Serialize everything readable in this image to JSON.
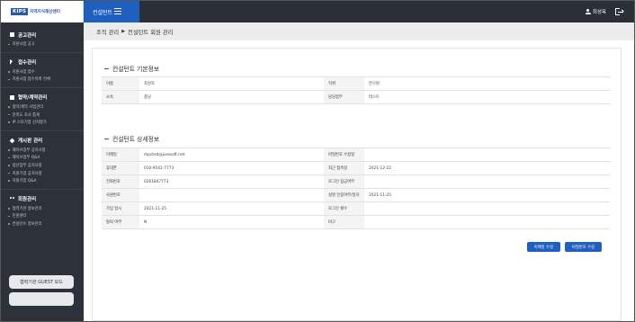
{
  "header": {
    "logo_mark": "KIPS",
    "logo_text": "지역지식재산센터",
    "brand": "컨설턴트",
    "user_name": "최성옥"
  },
  "sidebar": {
    "sections": [
      {
        "title": "공고관리",
        "icon": "document-icon",
        "items": [
          "지원사업 공고"
        ]
      },
      {
        "title": "접수관리",
        "icon": "cursor-icon",
        "items": [
          "지원사업 접수",
          "지원사업 접수목록 전체"
        ]
      },
      {
        "title": "협약/계약관리",
        "icon": "document-icon",
        "items": [
          "협약/계약 사업관리",
          "만족도 조사 통계",
          "IP 스타기업 선처평가"
        ]
      },
      {
        "title": "게시판 관리",
        "icon": "pencil-icon",
        "items": [
          "웨이브업무 공지사항",
          "웨이브업무 Q&A",
          "정산업무 공지사항",
          "지원기업 공지사항",
          "지원기업 Q&A"
        ]
      },
      {
        "title": "회원관리",
        "icon": "people-icon",
        "items": [
          "협력기관 정보관리",
          "민원센터",
          "컨설턴트 정보관리"
        ]
      }
    ],
    "guest_button": "협력기관 GUEST 모드"
  },
  "breadcrumb": {
    "parent": "조직 관리",
    "current": "컨설턴트 회원 관리"
  },
  "basic_info": {
    "title": "컨설턴트 기본정보",
    "rows": [
      [
        {
          "label": "이름",
          "value": "최성옥"
        },
        {
          "label": "직위",
          "value": "연구원"
        }
      ],
      [
        {
          "label": "소속",
          "value": "충남"
        },
        {
          "label": "담당업무",
          "value": "테스트"
        }
      ]
    ]
  },
  "detail_info": {
    "title": "컨설턴트 상세정보",
    "rows": [
      [
        {
          "label": "이메일",
          "value": "mpcted@juresoft.net"
        },
        {
          "label": "비밀번호 수정일",
          "value": ""
        }
      ],
      [
        {
          "label": "휴대폰",
          "value": "010-9541-7773"
        },
        {
          "label": "최근 접속일",
          "value": "2021-12-22"
        }
      ],
      [
        {
          "label": "전화번호",
          "value": "0261847773"
        },
        {
          "label": "로그인 잠금여부",
          "value": ""
        }
      ],
      [
        {
          "label": "사원번호",
          "value": ""
        },
        {
          "label": "실명 인증여부/일자",
          "value": "2021-11-25"
        }
      ],
      [
        {
          "label": "가입 일시",
          "value": "2021-11-25"
        },
        {
          "label": "로그인 횟수",
          "value": ""
        }
      ],
      [
        {
          "label": "탈퇴 여부",
          "value": "N"
        },
        {
          "label": "비고",
          "value": ""
        }
      ]
    ]
  },
  "buttons": {
    "email_edit": "이메일 수정",
    "password_edit": "비밀번호 수정"
  },
  "colors": {
    "accent": "#1f5fbf",
    "sidebar_bg": "#2d3139",
    "topbar_bg": "#2b2f38"
  }
}
